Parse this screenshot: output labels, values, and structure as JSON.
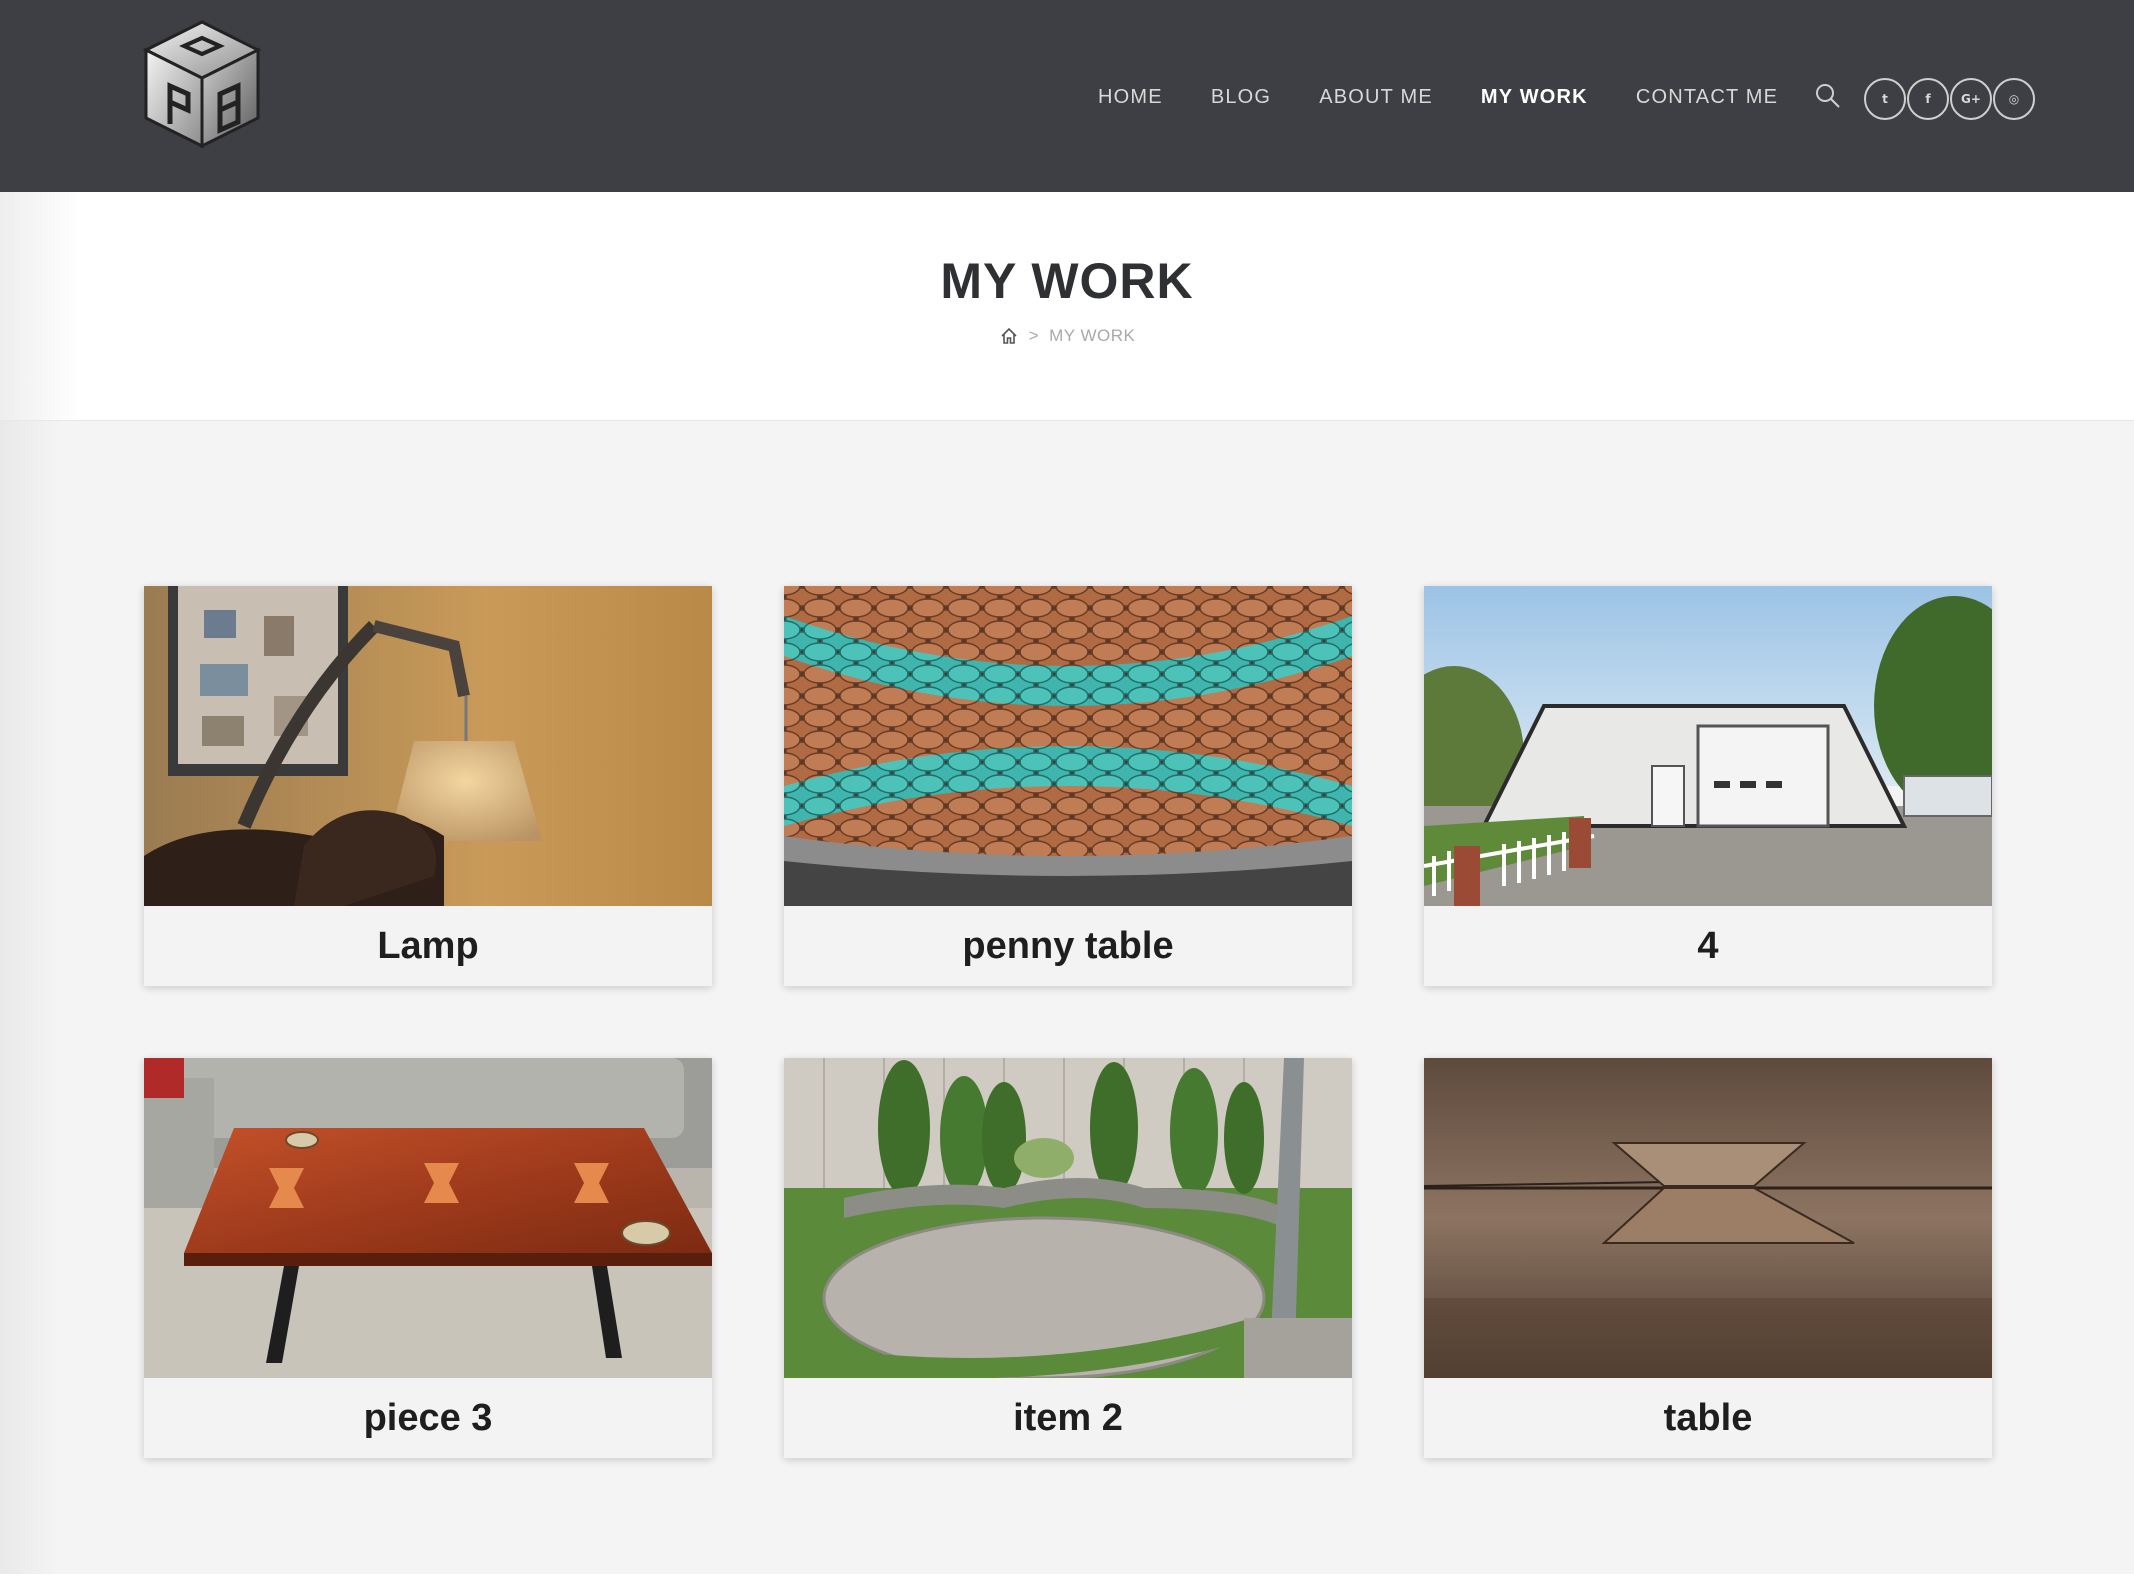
{
  "header": {
    "nav": [
      {
        "label": "HOME",
        "active": false
      },
      {
        "label": "BLOG",
        "active": false
      },
      {
        "label": "ABOUT ME",
        "active": false
      },
      {
        "label": "MY WORK",
        "active": true
      },
      {
        "label": "CONTACT ME",
        "active": false
      }
    ],
    "social": [
      "twitter-icon",
      "facebook-icon",
      "google-plus-icon",
      "instagram-icon"
    ],
    "social_glyphs": [
      "t",
      "f",
      "G+",
      "◎"
    ],
    "colors": {
      "bar": "#3d3f44",
      "text": "#d8d8d8",
      "active": "#ffffff"
    }
  },
  "page": {
    "title": "MY WORK",
    "breadcrumb_current": "MY WORK",
    "breadcrumb_separator": ">"
  },
  "portfolio": [
    {
      "title": "Lamp"
    },
    {
      "title": "penny table"
    },
    {
      "title": "4"
    },
    {
      "title": "piece 3"
    },
    {
      "title": "item 2"
    },
    {
      "title": "table"
    }
  ]
}
